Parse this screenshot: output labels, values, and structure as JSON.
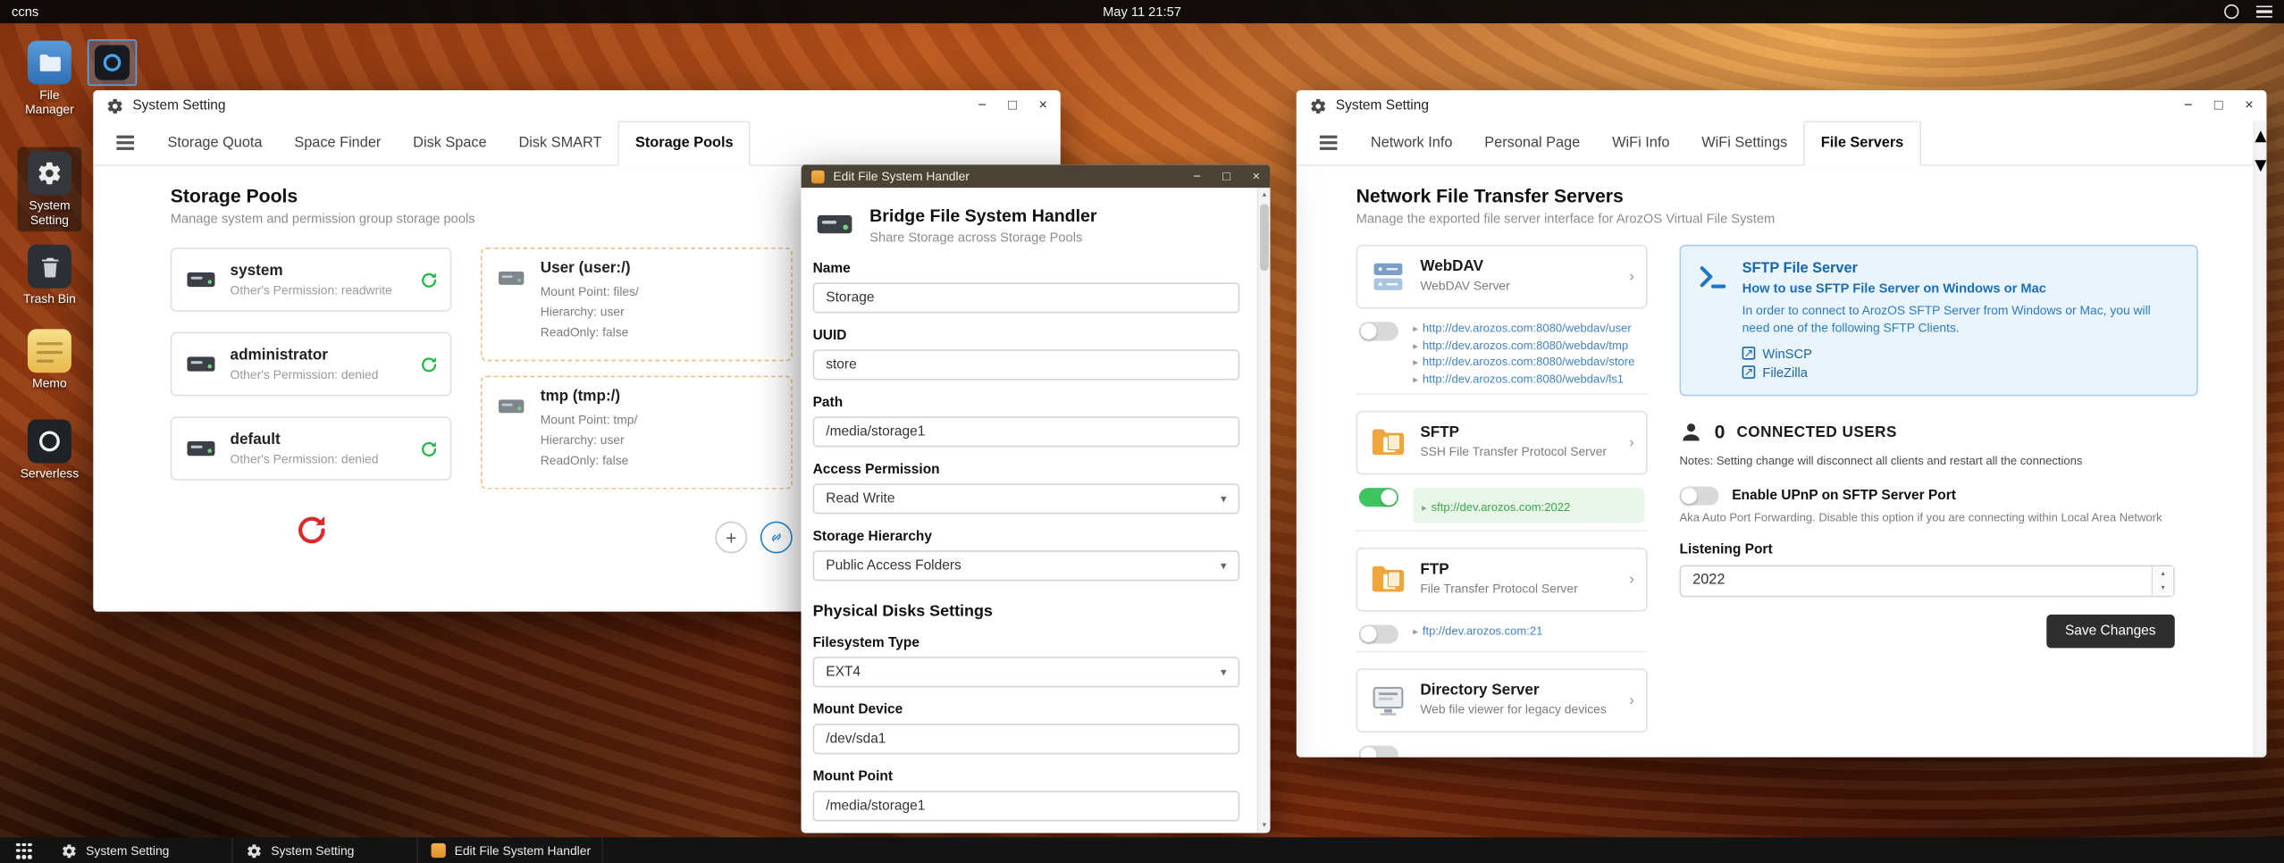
{
  "icons": {
    "minimize": "−",
    "maximize": "□",
    "close": "×",
    "caret_down": "▾",
    "caret_up": "▴",
    "chevron_right": "›",
    "bullet": "▸",
    "plus": "+",
    "external": "↗"
  },
  "colors": {
    "accent_blue": "#2185d0",
    "toggle_on_green": "#3fc560",
    "link_blue": "#4183c4",
    "sftp_green": "#39a845",
    "danger_red": "#db2828",
    "sync_green": "#21ba45",
    "save_button_dark": "#2e2e2e",
    "info_panel_bg": "#e9f4fd",
    "titlebar_dark": "#4a4336"
  },
  "topbar": {
    "host": "ccns",
    "clock": "May 11 21:57"
  },
  "desktop": {
    "icons": [
      {
        "label": "File Manager"
      },
      {
        "label": "System Setting"
      },
      {
        "label": "Trash Bin"
      },
      {
        "label": "Memo"
      },
      {
        "label": "Serverless"
      }
    ]
  },
  "storage_window": {
    "title": "System Setting",
    "tabs": [
      "Storage Quota",
      "Space Finder",
      "Disk Space",
      "Disk SMART",
      "Storage Pools"
    ],
    "heading": "Storage Pools",
    "subheading": "Manage system and permission group storage pools",
    "pools": [
      {
        "name": "system",
        "permission": "Other's Permission: readwrite"
      },
      {
        "name": "administrator",
        "permission": "Other's Permission: denied"
      },
      {
        "name": "default",
        "permission": "Other's Permission: denied"
      }
    ],
    "mounts": [
      {
        "name": "User (user:/)",
        "mount_point": "Mount Point: files/",
        "hierarchy": "Hierarchy: user",
        "readonly": "ReadOnly: false"
      },
      {
        "name": "tmp (tmp:/)",
        "mount_point": "Mount Point: tmp/",
        "hierarchy": "Hierarchy: user",
        "readonly": "ReadOnly: false"
      }
    ]
  },
  "editor_window": {
    "title": "Edit File System Handler",
    "heading": "Bridge File System Handler",
    "subheading": "Share Storage across Storage Pools",
    "name_label": "Name",
    "name_value": "Storage",
    "uuid_label": "UUID",
    "uuid_value": "store",
    "path_label": "Path",
    "path_value": "/media/storage1",
    "access_label": "Access Permission",
    "access_value": "Read Write",
    "hierarchy_label": "Storage Hierarchy",
    "hierarchy_value": "Public Access Folders",
    "section_physical": "Physical Disks Settings",
    "fs_label": "Filesystem Type",
    "fs_value": "EXT4",
    "mount_device_label": "Mount Device",
    "mount_device_value": "/dev/sda1",
    "mount_point_label": "Mount Point",
    "mount_point_value": "/media/storage1"
  },
  "servers_window": {
    "title": "System Setting",
    "tabs": [
      "Network Info",
      "Personal Page",
      "WiFi Info",
      "WiFi Settings",
      "File Servers"
    ],
    "heading": "Network File Transfer Servers",
    "subheading": "Manage the exported file server interface for ArozOS Virtual File System",
    "webdav": {
      "name": "WebDAV",
      "desc": "WebDAV Server",
      "links": [
        "http://dev.arozos.com:8080/webdav/user",
        "http://dev.arozos.com:8080/webdav/tmp",
        "http://dev.arozos.com:8080/webdav/store",
        "http://dev.arozos.com:8080/webdav/ls1"
      ]
    },
    "sftp": {
      "name": "SFTP",
      "desc": "SSH File Transfer Protocol Server",
      "link": "sftp://dev.arozos.com:2022"
    },
    "ftp": {
      "name": "FTP",
      "desc": "File Transfer Protocol Server",
      "link": "ftp://dev.arozos.com:21"
    },
    "directory": {
      "name": "Directory Server",
      "desc": "Web file viewer for legacy devices"
    },
    "sftp_info": {
      "title": "SFTP File Server",
      "subtitle": "How to use SFTP File Server on Windows or Mac",
      "body": "In order to connect to ArozOS SFTP Server from Windows or Mac, you will need one of the following SFTP Clients.",
      "clients": [
        "WinSCP",
        "FileZilla"
      ]
    },
    "connected_count": "0",
    "connected_label": "CONNECTED USERS",
    "connected_note": "Notes: Setting change will disconnect all clients and restart all the connections",
    "upnp_label": "Enable UPnP on SFTP Server Port",
    "upnp_note": "Aka Auto Port Forwarding. Disable this option if you are connecting within Local Area Network",
    "port_label": "Listening Port",
    "port_value": "2022",
    "save_label": "Save Changes"
  },
  "taskbar": {
    "items": [
      {
        "label": "System Setting"
      },
      {
        "label": "System Setting"
      },
      {
        "label": "Edit File System Handler"
      }
    ]
  }
}
